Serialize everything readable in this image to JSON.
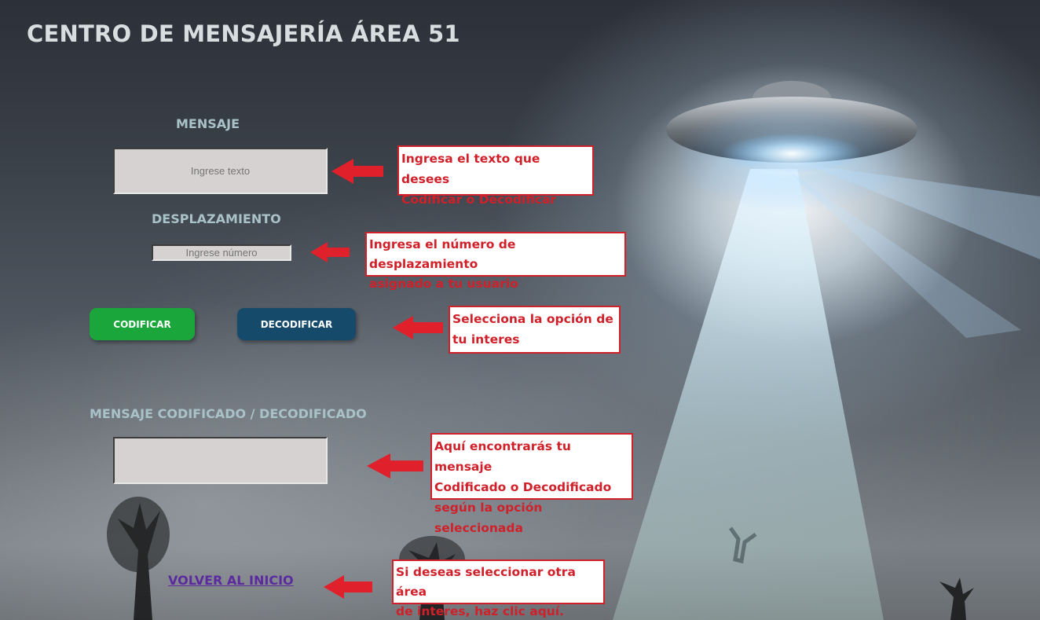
{
  "page": {
    "title": "CENTRO DE MENSAJERÍA ÁREA 51"
  },
  "form": {
    "message_label": "MENSAJE",
    "message_placeholder": "Ingrese texto",
    "message_value": "",
    "shift_label": "DESPLAZAMIENTO",
    "shift_placeholder": "Ingrese número",
    "shift_value": "",
    "encode_button": "CODIFICAR",
    "decode_button": "DECODIFICAR",
    "output_label": "MENSAJE CODIFICADO / DECODIFICADO",
    "output_value": "",
    "back_link": "VOLVER AL INICIO"
  },
  "annotations": [
    "Ingresa el texto que desees\nCodificar o Decodificar",
    "Ingresa el número de desplazamiento\nasignado a tu usuario",
    "Selecciona la opción de\ntu interes",
    "Aquí encontrarás tu mensaje\nCodificado o Decodificado\nsegún la opción seleccionada",
    "Si deseas seleccionar otra área\nde interes, haz clic aquí."
  ],
  "colors": {
    "encode_button": "#1aa63a",
    "decode_button": "#154a6a",
    "annotation": "#d0202a",
    "link": "#5a2a9e"
  }
}
